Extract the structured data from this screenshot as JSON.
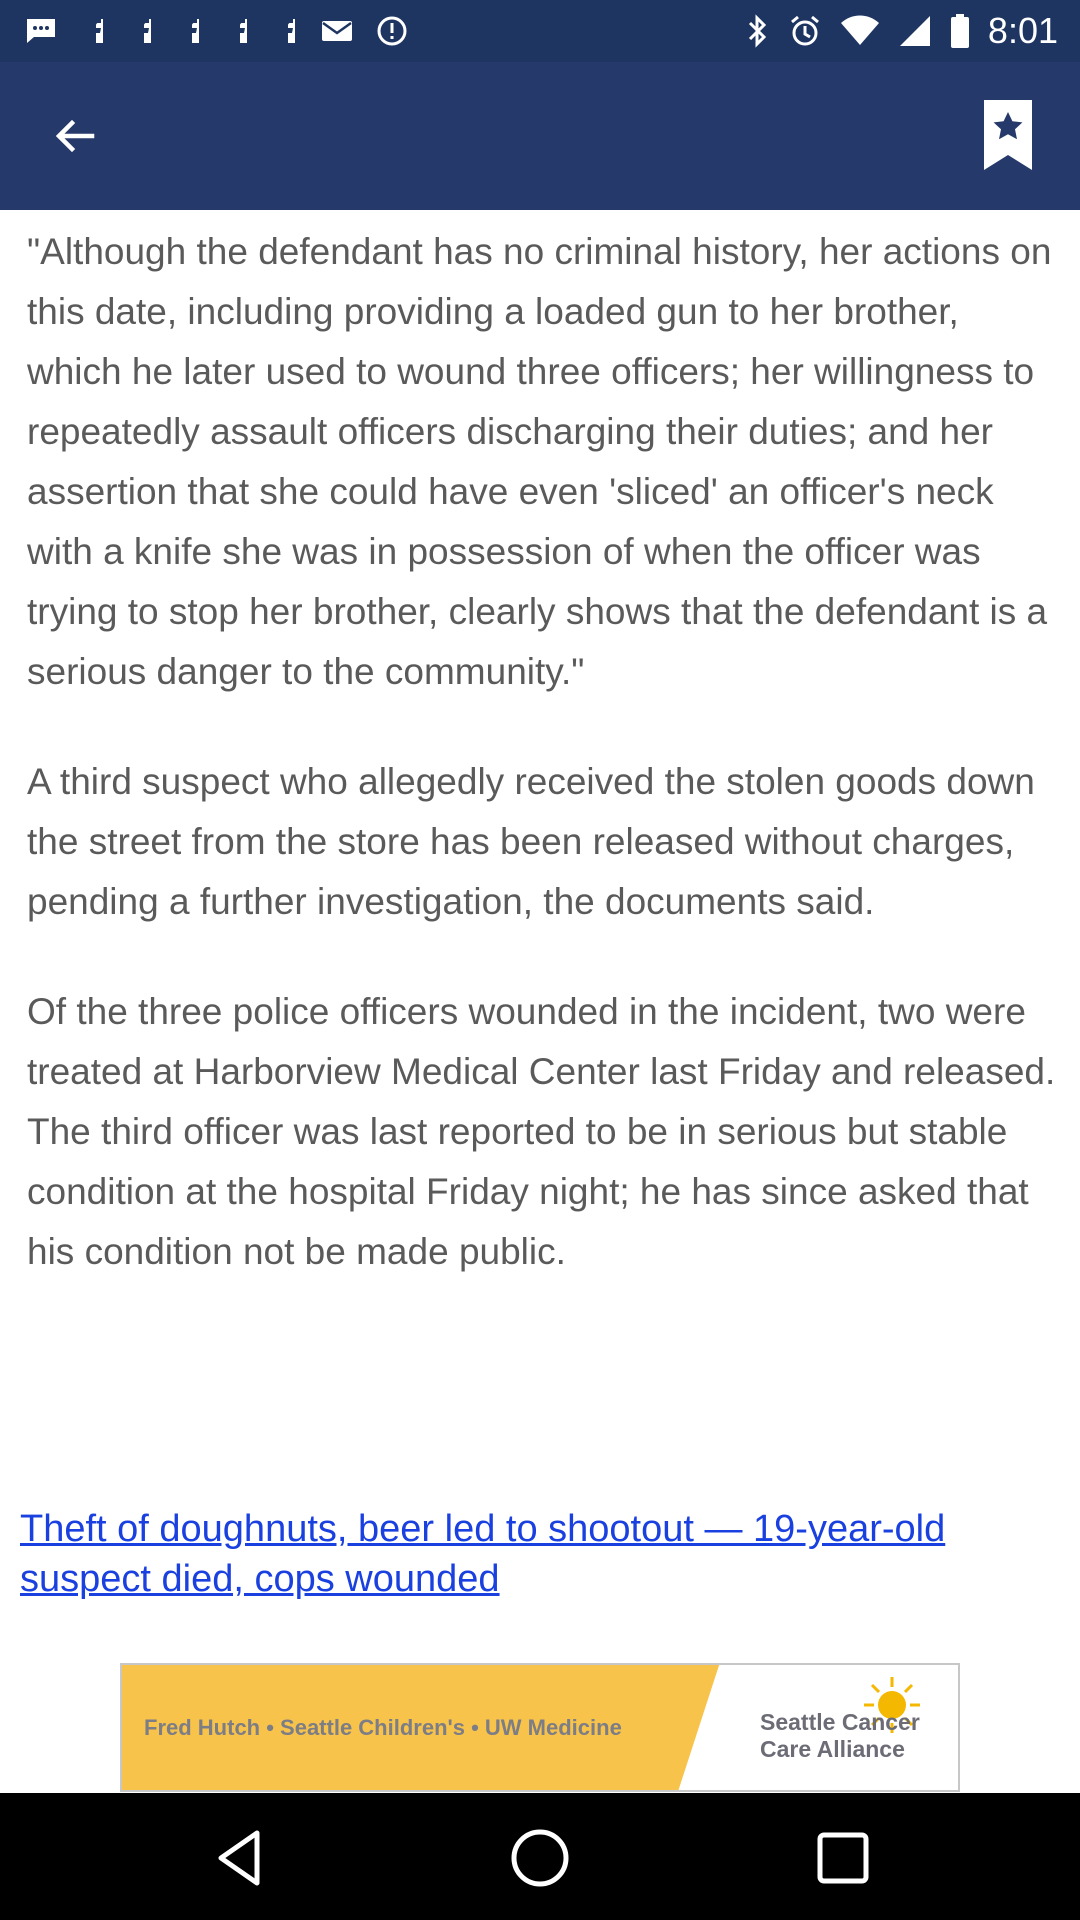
{
  "status_bar": {
    "time": "8:01",
    "left_icons": [
      "chat-icon",
      "facebook-icon",
      "facebook-icon",
      "facebook-icon",
      "facebook-icon",
      "facebook-icon",
      "mail-icon",
      "info-circle-icon"
    ],
    "right_icons": [
      "bluetooth-icon",
      "alarm-icon",
      "wifi-icon",
      "signal-icon",
      "battery-icon"
    ]
  },
  "app_bar": {
    "back_icon": "arrow-back-icon",
    "bookmark_icon": "bookmark-star-icon"
  },
  "article": {
    "paragraphs": [
      "\"Although the defendant has no criminal history, her actions on this date, including providing a loaded gun to her brother, which he later used to wound three officers; her willingness to repeatedly assault officers discharging their duties; and her assertion that she could have even 'sliced' an officer's neck with a knife she was in possession of when the officer was trying to stop her brother, clearly shows that the defendant is a serious danger to the community.\"",
      "A third suspect who allegedly received the stolen goods down the street from the store has been released without charges, pending a further investigation, the documents said.",
      "Of the three police officers wounded in the incident, two were treated at Harborview Medical Center last Friday and released. The third officer was last reported to be in serious but stable condition at the hospital Friday night; he has since asked that his condition not be made public."
    ],
    "related_link": "Theft of doughnuts, beer led to shootout — 19-year-old suspect died, cops wounded"
  },
  "ad": {
    "left_text": "Fred Hutch • Seattle Children's • UW Medicine",
    "brand_text": "Seattle Cancer Care Alliance",
    "colors": {
      "background": "#f7c34a",
      "sun": "#f5b800"
    }
  },
  "nav_bar": {
    "icons": [
      "back-triangle-icon",
      "home-circle-icon",
      "recents-square-icon"
    ]
  },
  "colors": {
    "status_bar": "#1e3461",
    "app_bar": "#25396a",
    "body_text": "#5a5a5a",
    "link": "#1a40e0"
  }
}
